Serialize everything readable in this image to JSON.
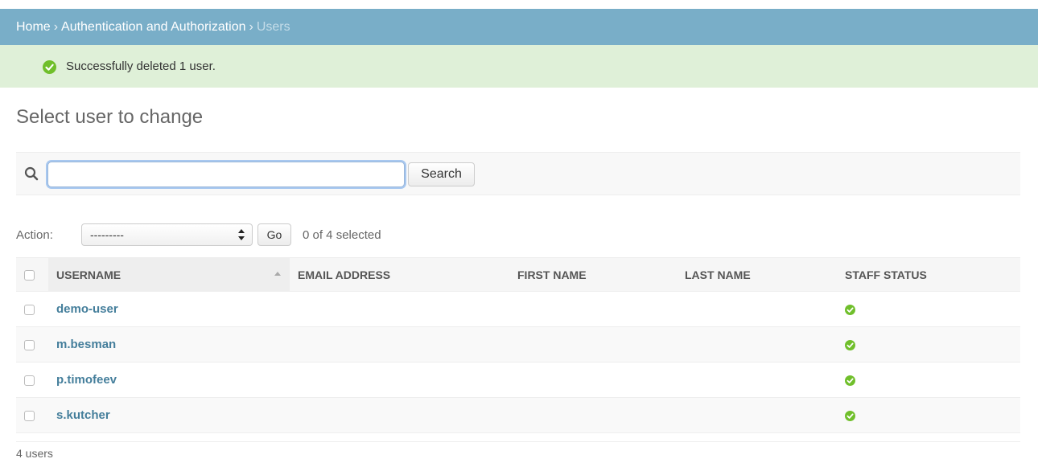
{
  "breadcrumbs": {
    "home": "Home",
    "section": "Authentication and Authorization",
    "current": "Users",
    "separator": "›"
  },
  "message": {
    "text": "Successfully deleted 1 user.",
    "icon": "check-circle-icon",
    "color": "#70bf2b"
  },
  "page": {
    "title": "Select user to change"
  },
  "search": {
    "icon": "search-icon",
    "value": "",
    "button_label": "Search"
  },
  "actions": {
    "label": "Action:",
    "selected_option": "---------",
    "go_label": "Go",
    "selected_count": "0 of 4 selected"
  },
  "table": {
    "columns": [
      {
        "label": "USERNAME"
      },
      {
        "label": "EMAIL ADDRESS"
      },
      {
        "label": "FIRST NAME"
      },
      {
        "label": "LAST NAME"
      },
      {
        "label": "STAFF STATUS"
      }
    ],
    "rows": [
      {
        "username": "demo-user",
        "email": "",
        "first_name": "",
        "last_name": "",
        "staff_status": true
      },
      {
        "username": "m.besman",
        "email": "",
        "first_name": "",
        "last_name": "",
        "staff_status": true
      },
      {
        "username": "p.timofeev",
        "email": "",
        "first_name": "",
        "last_name": "",
        "staff_status": true
      },
      {
        "username": "s.kutcher",
        "email": "",
        "first_name": "",
        "last_name": "",
        "staff_status": true
      }
    ]
  },
  "paginator": {
    "text": "4 users"
  },
  "colors": {
    "header_bg": "#79aec8",
    "message_bg": "#dff0d8",
    "link": "#447e9b",
    "success": "#70bf2b"
  }
}
